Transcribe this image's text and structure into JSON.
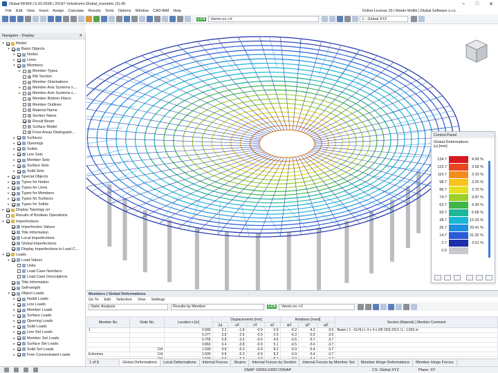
{
  "window": {
    "title": "Dlubal RFEM | 6.02.0038 | 20187-Velodromo-Dlubal_isometric (2).rf5"
  },
  "menu": [
    "File",
    "Edit",
    "View",
    "Insert",
    "Assign",
    "Calculate",
    "Results",
    "Tools",
    "Options",
    "Window",
    "CAD-BIM",
    "Help"
  ],
  "license": "Online License 29 | Martin Motlik | Dlubal Software s.r.o.",
  "toolbar": {
    "lc_badge": "LC4",
    "lc_name": "Viento en +X",
    "view_combo": "1 - Global XYZ"
  },
  "navigator": {
    "title": "Navigator - Display",
    "items": [
      {
        "label": "Model",
        "d": 0,
        "ex": "▾",
        "cb": true
      },
      {
        "label": "Basic Objects",
        "d": 1,
        "ex": "▾",
        "cb": true
      },
      {
        "label": "Nodes",
        "d": 2,
        "ex": "▸",
        "cb": true
      },
      {
        "label": "Lines",
        "d": 2,
        "ex": "▸",
        "cb": true
      },
      {
        "label": "Members",
        "d": 2,
        "ex": "▾",
        "cb": true
      },
      {
        "label": "Member Types",
        "d": 3,
        "ex": "▸",
        "cb": false
      },
      {
        "label": "Rib Section",
        "d": 3,
        "ex": "",
        "cb": false
      },
      {
        "label": "Member Orientations",
        "d": 3,
        "ex": "",
        "cb": false
      },
      {
        "label": "Member Axis Systems x,...",
        "d": 3,
        "ex": "▸",
        "cb": false
      },
      {
        "label": "Member Axis Systems x,...",
        "d": 3,
        "ex": "▸",
        "cb": false
      },
      {
        "label": "Member Bottom Fibers",
        "d": 3,
        "ex": "",
        "cb": false
      },
      {
        "label": "Member Outlines",
        "d": 3,
        "ex": "",
        "cb": false
      },
      {
        "label": "Material Name",
        "d": 3,
        "ex": "",
        "cb": false
      },
      {
        "label": "Section Name",
        "d": 3,
        "ex": "",
        "cb": false
      },
      {
        "label": "Result Beam",
        "d": 3,
        "ex": "",
        "cb": true
      },
      {
        "label": "Surface Model",
        "d": 3,
        "ex": "",
        "cb": false
      },
      {
        "label": "Front Areas Distinguish...",
        "d": 3,
        "ex": "",
        "cb": false
      },
      {
        "label": "Surfaces",
        "d": 2,
        "ex": "▸",
        "cb": true
      },
      {
        "label": "Openings",
        "d": 2,
        "ex": "▸",
        "cb": true
      },
      {
        "label": "Solids",
        "d": 2,
        "ex": "▸",
        "cb": true
      },
      {
        "label": "Line Sets",
        "d": 2,
        "ex": "▸",
        "cb": true
      },
      {
        "label": "Member Sets",
        "d": 2,
        "ex": "▸",
        "cb": true
      },
      {
        "label": "Surface Sets",
        "d": 2,
        "ex": "▸",
        "cb": true
      },
      {
        "label": "Solid Sets",
        "d": 2,
        "ex": "▸",
        "cb": true
      },
      {
        "label": "Special Objects",
        "d": 1,
        "ex": "▸",
        "cb": true
      },
      {
        "label": "Types for Nodes",
        "d": 1,
        "ex": "▸",
        "cb": true
      },
      {
        "label": "Types for Lines",
        "d": 1,
        "ex": "▸",
        "cb": true
      },
      {
        "label": "Types for Members",
        "d": 1,
        "ex": "▸",
        "cb": true
      },
      {
        "label": "Types for Surfaces",
        "d": 1,
        "ex": "▸",
        "cb": true
      },
      {
        "label": "Types for Solids",
        "d": 1,
        "ex": "▸",
        "cb": true
      },
      {
        "label": "Display Topology on",
        "d": 0,
        "ex": "▸",
        "cb": true
      },
      {
        "label": "Results of Boolean Operations",
        "d": 0,
        "ex": "",
        "cb": false
      },
      {
        "label": "Imperfections",
        "d": 0,
        "ex": "▾",
        "cb": true
      },
      {
        "label": "Imperfection Values",
        "d": 1,
        "ex": "",
        "cb": true
      },
      {
        "label": "Title Information",
        "d": 1,
        "ex": "",
        "cb": true
      },
      {
        "label": "Local Imperfections",
        "d": 1,
        "ex": "",
        "cb": true
      },
      {
        "label": "Global Imperfections",
        "d": 1,
        "ex": "",
        "cb": true
      },
      {
        "label": "Display Imperfections in Load C...",
        "d": 1,
        "ex": "",
        "cb": true
      },
      {
        "label": "Loads",
        "d": 0,
        "ex": "▾",
        "cb": true
      },
      {
        "label": "Load Values",
        "d": 1,
        "ex": "▾",
        "cb": true
      },
      {
        "label": "Units",
        "d": 2,
        "ex": "",
        "cb": false
      },
      {
        "label": "Load Case Numbers",
        "d": 2,
        "ex": "",
        "cb": false
      },
      {
        "label": "Load Case Descriptions",
        "d": 2,
        "ex": "",
        "cb": false
      },
      {
        "label": "Title Information",
        "d": 1,
        "ex": "",
        "cb": true
      },
      {
        "label": "Self-weight",
        "d": 1,
        "ex": "",
        "cb": true
      },
      {
        "label": "Object Loads",
        "d": 1,
        "ex": "▾",
        "cb": true
      },
      {
        "label": "Nodal Loads",
        "d": 2,
        "ex": "▸",
        "cb": true
      },
      {
        "label": "Line Loads",
        "d": 2,
        "ex": "▸",
        "cb": true
      },
      {
        "label": "Member Loads",
        "d": 2,
        "ex": "▸",
        "cb": true
      },
      {
        "label": "Surface Loads",
        "d": 2,
        "ex": "▸",
        "cb": true
      },
      {
        "label": "Opening Loads",
        "d": 2,
        "ex": "▸",
        "cb": true
      },
      {
        "label": "Solid Loads",
        "d": 2,
        "ex": "▸",
        "cb": true
      },
      {
        "label": "Line Set Loads",
        "d": 2,
        "ex": "▸",
        "cb": true
      },
      {
        "label": "Member Set Loads",
        "d": 2,
        "ex": "▸",
        "cb": true
      },
      {
        "label": "Surface Set Loads",
        "d": 2,
        "ex": "▸",
        "cb": true
      },
      {
        "label": "Solid Set Loads",
        "d": 2,
        "ex": "▸",
        "cb": true
      },
      {
        "label": "Free Concentrated Loads",
        "d": 2,
        "ex": "▸",
        "cb": true
      }
    ]
  },
  "control_panel": {
    "title": "Control Panel",
    "subtitle": "Global Deformations",
    "unit": "|u| [mm]",
    "legend": [
      {
        "v": "134.7",
        "p": "4.99 %",
        "c": "#d71920"
      },
      {
        "v": "122.7",
        "p": "3.58 %",
        "c": "#e8461f"
      },
      {
        "v": "110.7",
        "p": "3.10 %",
        "c": "#f28c1e"
      },
      {
        "v": "98.7",
        "p": "3.25 %",
        "c": "#f7c21c"
      },
      {
        "v": "86.7",
        "p": "3.70 %",
        "c": "#e4e01f"
      },
      {
        "v": "74.7",
        "p": "3.87 %",
        "c": "#9ccf2a"
      },
      {
        "v": "62.7",
        "p": "4.30 %",
        "c": "#3fb54a"
      },
      {
        "v": "50.7",
        "p": "5.68 %",
        "c": "#1fb59a"
      },
      {
        "v": "38.7",
        "p": "12.20 %",
        "c": "#1ab7d6"
      },
      {
        "v": "26.7",
        "p": "20.41 %",
        "c": "#1f8fe0"
      },
      {
        "v": "14.7",
        "p": "31.32 %",
        "c": "#2a5bd7"
      },
      {
        "v": "2.7",
        "p": "3.61 %",
        "c": "#1c2fa8"
      },
      {
        "v": "0.0",
        "p": "",
        "c": "#c7c9cc"
      }
    ]
  },
  "panel": {
    "title": "Members | Global Deformations",
    "menu": [
      "Go To",
      "Edit",
      "Selection",
      "View",
      "Settings"
    ],
    "analysis": "Static Analysis",
    "results_by": "Results by Member",
    "lc_badge": "LC4",
    "lc_name": "Viento en +X",
    "headers": {
      "member": "Member No.",
      "node": "Node No.",
      "location": "Location x [m]",
      "displacements": "Displacements [mm]",
      "rotations": "Rotations [mrad]",
      "u": "|u|",
      "ux": "uX",
      "uy": "uY",
      "uz": "uZ",
      "phix": "φX",
      "phiy": "φY",
      "phiz": "φZ",
      "section": "Section (Material) | Member Comment"
    },
    "rows": [
      {
        "m": "1",
        "n": "",
        "x": "0.000",
        "u": "2.2",
        "ux": "-1.8",
        "uy": "-0.9",
        "uz": "0.9",
        "px": "-6.2",
        "py": "-4.2",
        "pz": "-3.5",
        "sec": "Beam | 1 - 2LHLI L 4 x 4 x 3/8 /203.2/9.5 | L: 1.500 m"
      },
      {
        "m": "",
        "n": "",
        "x": "0.377",
        "u": "3.8",
        "ux": "-2.6",
        "uy": "-0.9",
        "uz": "2.6",
        "px": "-6.3",
        "py": "-5.5",
        "pz": "-3.5",
        "sec": ""
      },
      {
        "m": "",
        "n": "",
        "x": "0.755",
        "u": "5.8",
        "ux": "-3.5",
        "uy": "-0.9",
        "uz": "4.5",
        "px": "-6.5",
        "py": "-5.7",
        "pz": "-3.7",
        "sec": ""
      },
      {
        "m": "",
        "n": "",
        "x": "0.863",
        "u": "6.4",
        "ux": "-3.8",
        "uy": "-0.9",
        "uz": "5.1",
        "px": "-6.5",
        "py": "-5.6",
        "pz": "-3.7",
        "sec": ""
      },
      {
        "m": "",
        "n": "114",
        "x": "1.500",
        "u": "9.8",
        "ux": "-5.3",
        "uy": "-0.9",
        "uz": "8.2",
        "px": "-6.9",
        "py": "-5.4",
        "pz": "-3.7",
        "sec": ""
      },
      {
        "m": "Extremes",
        "n": "114",
        "x": "1.500",
        "u": "9.8",
        "ux": "-5.3",
        "uy": "-0.9",
        "uz": "8.2",
        "px": "-6.9",
        "py": "-5.4",
        "pz": "-3.7",
        "sec": ""
      },
      {
        "m": "",
        "n": "114",
        "x": "1.500",
        "u": "9.8",
        "ux": "-5.3",
        "uy": "-0.9",
        "uz": "8.2",
        "px": "-6.9",
        "py": "-5.4",
        "pz": "-3.7",
        "sec": ""
      }
    ],
    "pager": "1 of 8",
    "tabs": [
      "Global Deformations",
      "Local Deformations",
      "Internal Forces",
      "Strains",
      "Internal Forces by Section",
      "Internal Forces by Member Set",
      "Member Hinge Deformations",
      "Member Hinge Forces"
    ]
  },
  "status": {
    "snap": "SNAP",
    "grid": "GRID",
    "lgrid": "LGRID",
    "osnap": "OSNAP",
    "cs": "CS: Global XYZ",
    "plane": "Plane: XY"
  }
}
